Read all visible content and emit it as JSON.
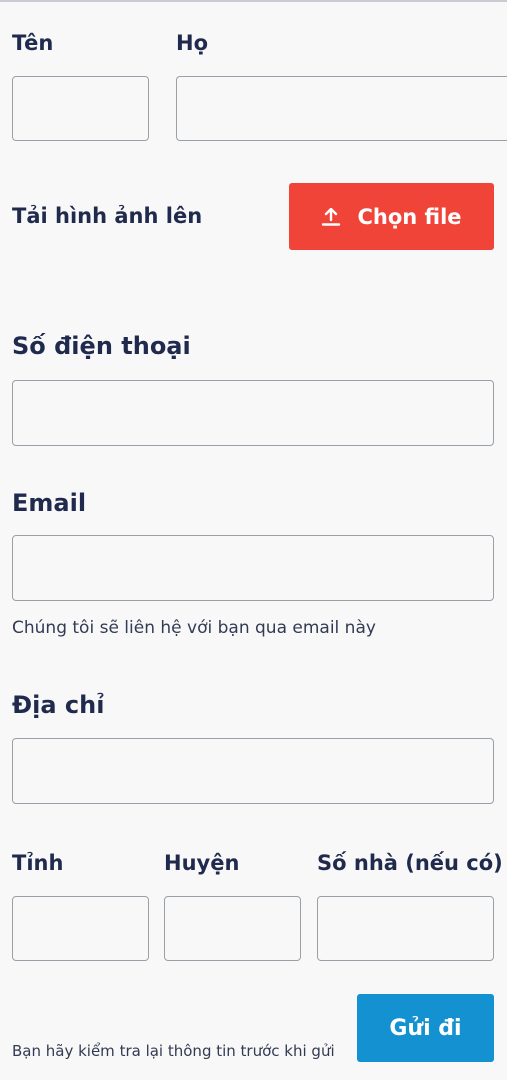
{
  "form": {
    "first_name_label": "Tên",
    "last_name_label": "Họ",
    "upload_label": "Tải hình ảnh lên",
    "upload_button_label": "Chọn file",
    "phone_label": "Số điện thoại",
    "email_label": "Email",
    "email_helper": "Chúng tôi sẽ liên hệ với bạn qua email này",
    "address_label": "Địa chỉ",
    "province_label": "Tỉnh",
    "district_label": "Huyện",
    "house_number_label": "Số nhà (nếu có)",
    "submit_label": "Gửi đi",
    "review_note": "Bạn hãy kiểm tra lại thông tin trước khi gửi",
    "fields": {
      "first_name": "",
      "last_name": "",
      "phone": "",
      "email": "",
      "address": "",
      "province": "",
      "district": "",
      "house_number": ""
    }
  },
  "icons": {
    "upload": "upload-icon"
  },
  "colors": {
    "text": "#1f2a4d",
    "upload_button": "#f04438",
    "submit_button": "#1391d0",
    "input_border": "#9aa0a8",
    "background": "#f8f8f9"
  }
}
